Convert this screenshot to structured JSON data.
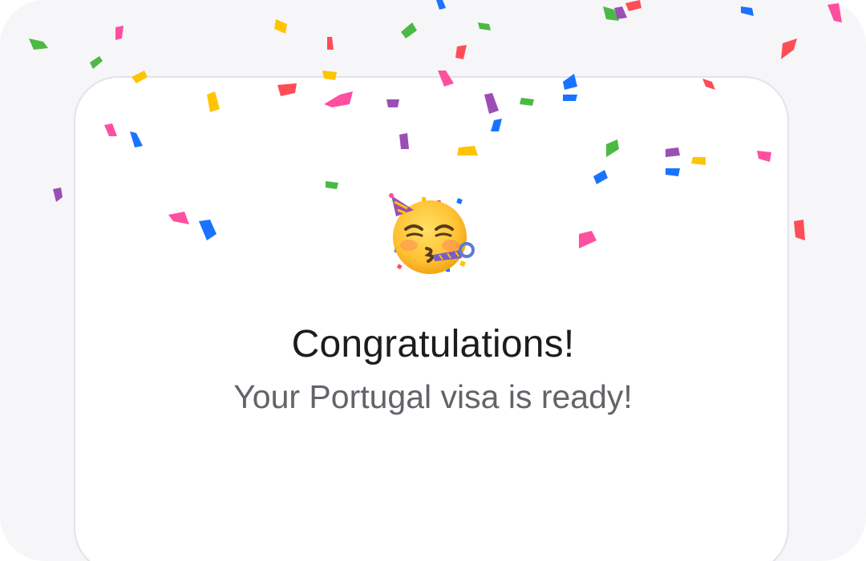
{
  "dialog": {
    "emoji_name": "partying-face-emoji",
    "title": "Congratulations!",
    "subtitle": "Your Portugal visa is ready!"
  },
  "colors": {
    "background": "#f6f6f8",
    "card": "#ffffff",
    "card_border": "#e3e3e8",
    "title": "#1c1c1e",
    "subtitle": "#636369",
    "confetti": [
      "#4cb944",
      "#ff4d57",
      "#ff4fa0",
      "#ffc400",
      "#1a73ff",
      "#9b4fb5"
    ]
  }
}
